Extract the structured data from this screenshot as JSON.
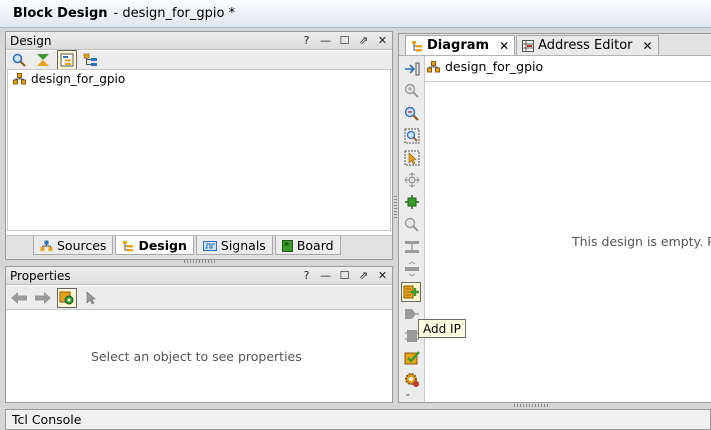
{
  "window": {
    "title_bold": "Block Design",
    "title_rest": "- design_for_gpio *"
  },
  "design_panel": {
    "title": "Design",
    "controls": [
      "?",
      "—",
      "☐",
      "⇗",
      "✕"
    ],
    "tree_item": "design_for_gpio",
    "tabs": [
      {
        "label": "Sources",
        "icon": "sources-icon",
        "active": false
      },
      {
        "label": "Design",
        "icon": "design-icon",
        "active": true
      },
      {
        "label": "Signals",
        "icon": "signals-icon",
        "active": false
      },
      {
        "label": "Board",
        "icon": "board-icon",
        "active": false
      }
    ]
  },
  "properties_panel": {
    "title": "Properties",
    "controls": [
      "?",
      "—",
      "☐",
      "⇗",
      "✕"
    ],
    "empty_message": "Select an object to see properties"
  },
  "diagram_panel": {
    "tabs": [
      {
        "label": "Diagram",
        "active": true,
        "close": "✕"
      },
      {
        "label": "Address Editor",
        "active": false,
        "close": "✕"
      }
    ],
    "breadcrumb": "design_for_gpio",
    "empty_message": "This design is empty. P",
    "tooltip": "Add IP"
  },
  "console": {
    "label": "Tcl Console"
  },
  "colors": {
    "accent_orange": "#e8a317",
    "icon_blue": "#2f6fc0",
    "icon_green": "#3a9a2c"
  }
}
